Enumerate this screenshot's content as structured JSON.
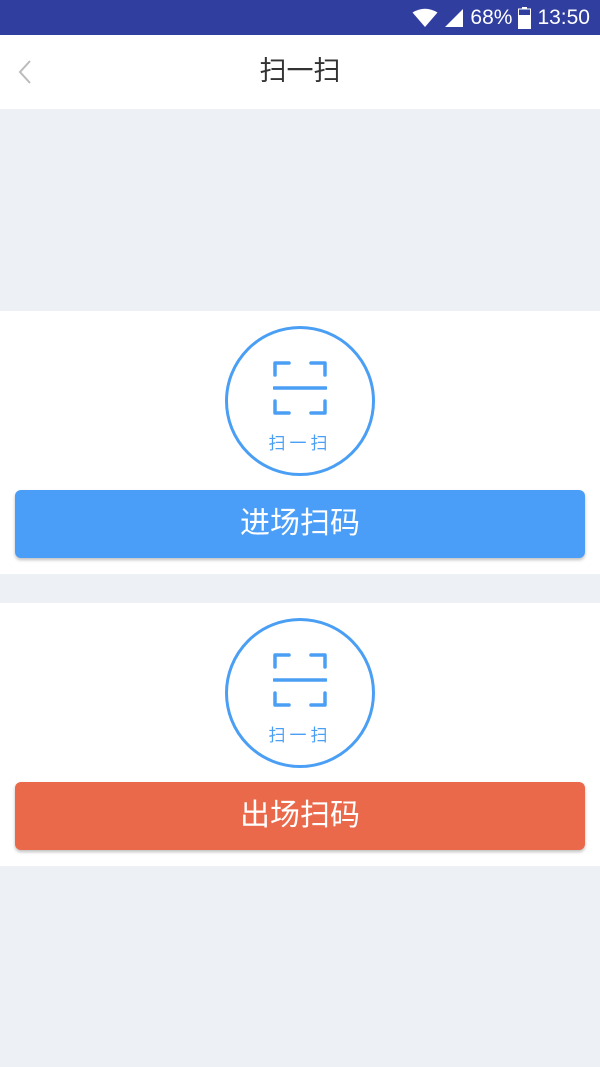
{
  "status_bar": {
    "battery": "68%",
    "time": "13:50"
  },
  "nav": {
    "title": "扫一扫",
    "back_icon": "chevron-left-icon"
  },
  "cards": {
    "entry": {
      "scan_label": "扫一扫",
      "button_label": "进场扫码",
      "button_color": "#4a9ef8"
    },
    "exit": {
      "scan_label": "扫一扫",
      "button_label": "出场扫码",
      "button_color": "#ea694b"
    }
  },
  "colors": {
    "status_bar": "#303f9f",
    "accent": "#4a9ff5",
    "background": "#edf1f5"
  }
}
